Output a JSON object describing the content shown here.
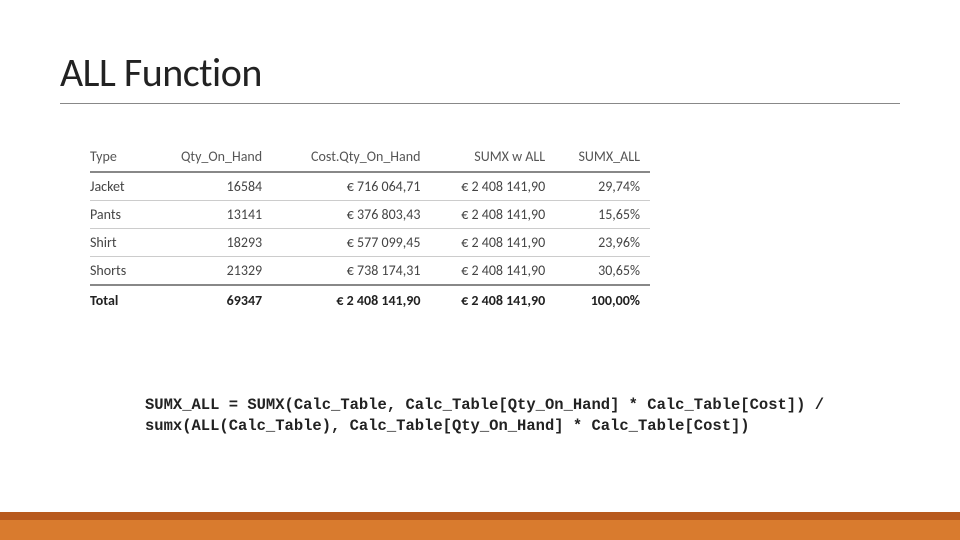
{
  "title": "ALL Function",
  "chart_data": {
    "type": "table",
    "columns": [
      "Type",
      "Qty_On_Hand",
      "Cost.Qty_On_Hand",
      "SUMX w ALL",
      "SUMX_ALL"
    ],
    "rows": [
      {
        "type": "Jacket",
        "qty": "16584",
        "cost_qty": "€ 716 064,71",
        "sumx_w_all": "€ 2 408 141,90",
        "sumx_all": "29,74%"
      },
      {
        "type": "Pants",
        "qty": "13141",
        "cost_qty": "€ 376 803,43",
        "sumx_w_all": "€ 2 408 141,90",
        "sumx_all": "15,65%"
      },
      {
        "type": "Shirt",
        "qty": "18293",
        "cost_qty": "€ 577 099,45",
        "sumx_w_all": "€ 2 408 141,90",
        "sumx_all": "23,96%"
      },
      {
        "type": "Shorts",
        "qty": "21329",
        "cost_qty": "€ 738 174,31",
        "sumx_w_all": "€ 2 408 141,90",
        "sumx_all": "30,65%"
      }
    ],
    "total": {
      "type": "Total",
      "qty": "69347",
      "cost_qty": "€ 2 408 141,90",
      "sumx_w_all": "€ 2 408 141,90",
      "sumx_all": "100,00%"
    }
  },
  "code": {
    "line1": "SUMX_ALL = SUMX(Calc_Table, Calc_Table[Qty_On_Hand] * Calc_Table[Cost]) /",
    "line2": "sumx(ALL(Calc_Table), Calc_Table[Qty_On_Hand] * Calc_Table[Cost])"
  }
}
